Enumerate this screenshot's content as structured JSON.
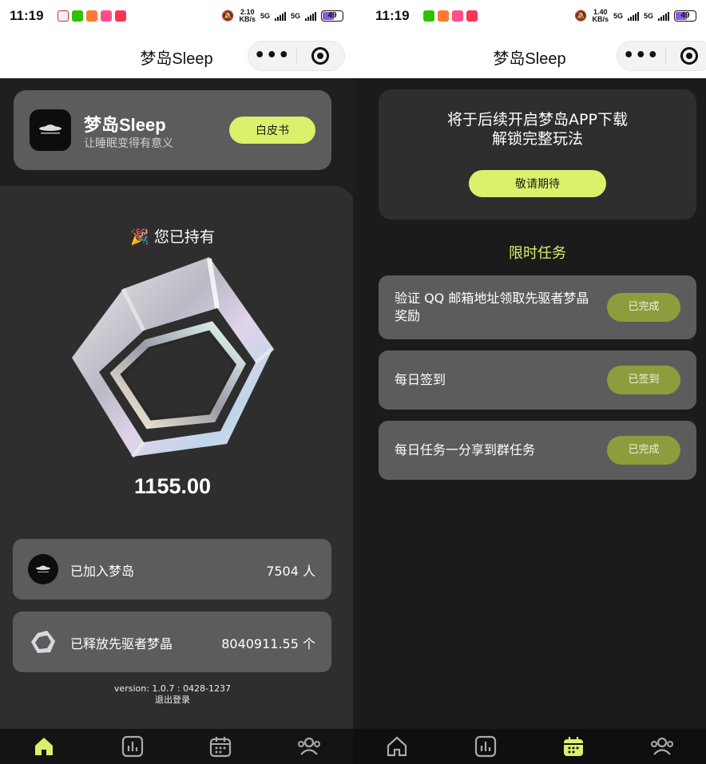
{
  "status_left": {
    "time": "11:19",
    "net_speed": "2.10",
    "net_unit": "KB/s",
    "signal1": "5G",
    "signal2": "5G",
    "battery": "49"
  },
  "status_right": {
    "time": "11:19",
    "net_speed": "1.40",
    "net_unit": "KB/s",
    "signal1": "5G",
    "signal2": "5G",
    "battery": "49"
  },
  "colors": {
    "accent": "#dbf06b",
    "done_button": "#8d9c3c",
    "card": "#5c5c5c",
    "panel": "#2e2e2e"
  },
  "left": {
    "nav_title": "梦岛Sleep",
    "brand": {
      "name": "梦岛Sleep",
      "slogan": "让睡眠变得有意义",
      "whitepaper_button": "白皮书"
    },
    "owned_label": "🎉 您已持有",
    "amount": "1155.00",
    "stats": [
      {
        "label": "已加入梦岛",
        "value": "7504 人",
        "icon": "logo-icon"
      },
      {
        "label": "已释放先驱者梦晶",
        "value": "8040911.55 个",
        "icon": "crystal-icon"
      }
    ],
    "version": "version: 1.0.7 : 0428-1237",
    "logout": "退出登录",
    "tabs": [
      "home-icon",
      "chart-icon",
      "calendar-icon",
      "friends-icon"
    ],
    "active_tab": 0
  },
  "right": {
    "nav_title": "梦岛Sleep",
    "notice": {
      "line1": "将于后续开启梦岛APP下载",
      "line2": "解锁完整玩法",
      "button": "敬请期待"
    },
    "section_title": "限时任务",
    "tasks": [
      {
        "label": "验证 QQ 邮箱地址领取先驱者梦晶奖励",
        "button": "已完成"
      },
      {
        "label": "每日签到",
        "button": "已签到"
      },
      {
        "label": "每日任务一分享到群任务",
        "button": "已完成"
      }
    ],
    "tabs": [
      "home-icon",
      "chart-icon",
      "calendar-icon",
      "friends-icon"
    ],
    "active_tab": 2
  }
}
